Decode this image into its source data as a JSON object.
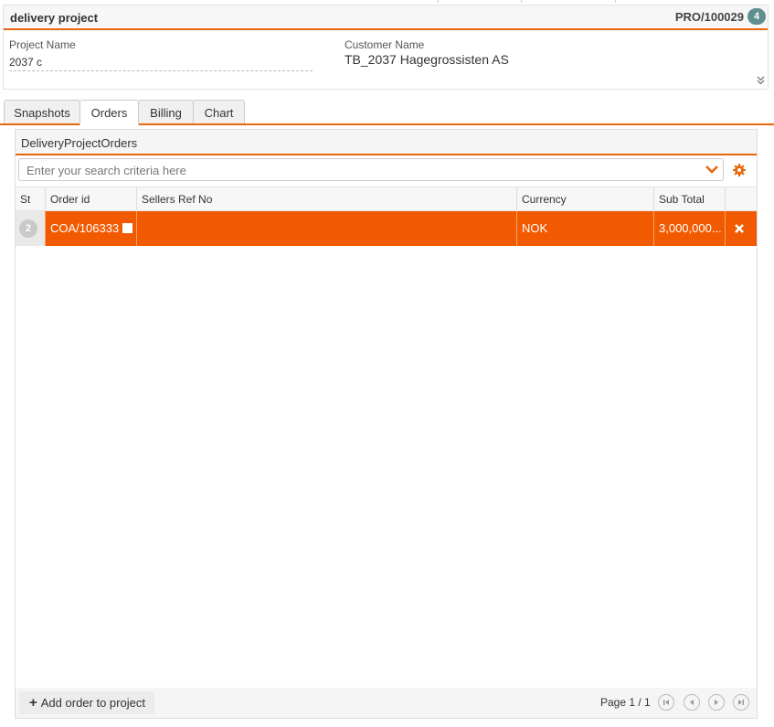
{
  "card": {
    "title": "delivery project",
    "code": "PRO/100029",
    "badge_count": "4",
    "project_name_label": "Project Name",
    "project_name_value": "2037 c",
    "customer_name_label": "Customer Name",
    "customer_name_value": "TB_2037 Hagegrossisten AS",
    "expand_icon": "double-chevron-down-icon"
  },
  "tabs": [
    {
      "label": "Snapshots",
      "active": false
    },
    {
      "label": "Orders",
      "active": true
    },
    {
      "label": "Billing",
      "active": false
    },
    {
      "label": "Chart",
      "active": false
    }
  ],
  "panel": {
    "title": "DeliveryProjectOrders",
    "search_placeholder": "Enter your search criteria here",
    "search_value": "",
    "columns": [
      "St",
      "Order id",
      "Sellers Ref No",
      "Currency",
      "Sub Total"
    ],
    "rows": [
      {
        "status": "2",
        "order_id": "COA/106333",
        "sellers_ref_no": "",
        "currency": "NOK",
        "sub_total": "3,000,000..."
      }
    ],
    "add_button_label": "Add order to project",
    "page_info": "Page 1 / 1"
  },
  "colors": {
    "accent": "#e8660c",
    "selected_row": "#f15a00",
    "badge": "#5f8e90"
  }
}
